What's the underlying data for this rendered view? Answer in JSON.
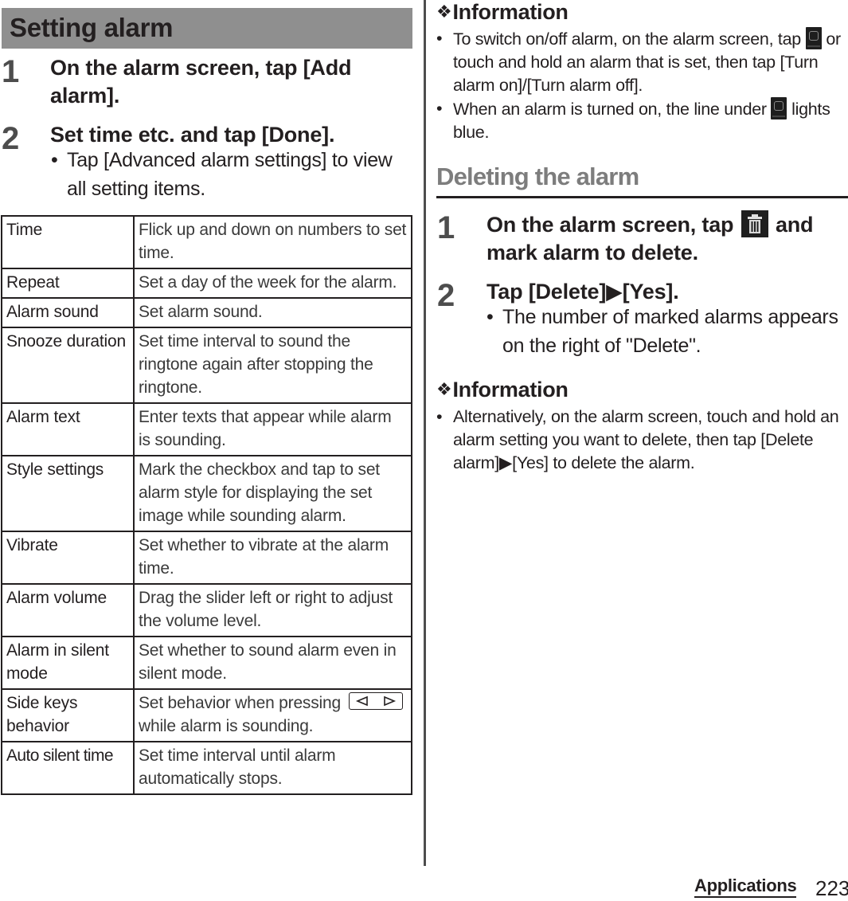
{
  "section_title": "Setting alarm",
  "setting_steps": [
    {
      "number": "1",
      "text": "On the alarm screen, tap [Add alarm]."
    },
    {
      "number": "2",
      "text": "Set time etc. and tap [Done].",
      "bullet": "Tap [Advanced alarm settings] to view all setting items."
    }
  ],
  "bullet_glyph": "•",
  "settings_table": [
    {
      "item": "Time",
      "description": "Flick up and down on numbers to set time."
    },
    {
      "item": "Repeat",
      "description": "Set a day of the week for the alarm."
    },
    {
      "item": "Alarm sound",
      "description": "Set alarm sound."
    },
    {
      "item": "Snooze duration",
      "description": "Set time interval to sound the ringtone again after stopping the ringtone."
    },
    {
      "item": "Alarm text",
      "description": "Enter texts that appear while alarm is sounding."
    },
    {
      "item": "Style settings",
      "description": "Mark the checkbox and tap to set alarm style for displaying the set image while sounding alarm."
    },
    {
      "item": "Vibrate",
      "description": "Set whether to vibrate at the alarm time."
    },
    {
      "item": "Alarm volume",
      "description": "Drag the slider left or right to adjust the volume level."
    },
    {
      "item": "Alarm in silent mode",
      "description": "Set whether to sound alarm even in silent mode."
    },
    {
      "item": "Side keys behavior",
      "description_before_icon": "Set behavior when pressing",
      "icon": "side-keys-icon",
      "description_after_icon": "while alarm is sounding."
    },
    {
      "item": "Auto silent time",
      "description": "Set time interval until alarm automatically stops."
    }
  ],
  "info_1": {
    "heading_glyph": "❖",
    "heading": "Information",
    "bullets": [
      {
        "before_icon": "To switch on/off alarm, on the alarm screen, tap",
        "icon": "alarm-clock-icon",
        "after_icon": "or touch and hold an alarm that is set, then tap [Turn alarm on]/[Turn alarm off]."
      },
      {
        "before_icon": "When an alarm is turned on, the line under",
        "icon": "alarm-clock-icon",
        "after_icon": "lights blue."
      }
    ]
  },
  "delete_section": {
    "title": "Deleting the alarm",
    "steps": [
      {
        "number": "1",
        "before_icon": "On the alarm screen, tap",
        "icon": "trash-icon",
        "after_icon": "and mark alarm to delete."
      },
      {
        "number": "2",
        "text": "Tap [Delete]▶[Yes].",
        "bullet": "The number of marked alarms appears on the right of \"Delete\"."
      }
    ]
  },
  "info_2": {
    "heading_glyph": "❖",
    "heading": "Information",
    "bullets": [
      {
        "text": "Alternatively, on the alarm screen, touch and hold an alarm setting you want to delete, then tap [Delete alarm]▶[Yes] to delete the alarm."
      }
    ]
  },
  "footer": {
    "chapter": "Applications",
    "page_number": "223"
  },
  "colors": {
    "section_bar": "#8f8f8f",
    "subhead": "#7d7d7d",
    "text": "#231f20",
    "step_number": "#4d4d4d"
  }
}
